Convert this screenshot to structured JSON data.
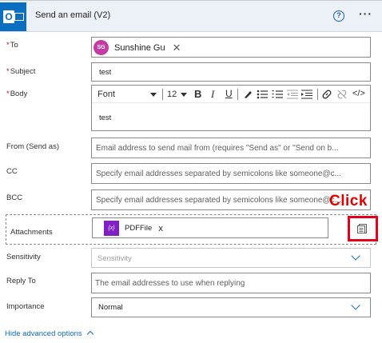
{
  "header": {
    "title": "Send an email (V2)",
    "help_icon": "help-circle-icon",
    "more_icon": "more-horizontal-icon",
    "more_glyph": "···",
    "help_glyph": "?"
  },
  "fields": {
    "to": {
      "required_mark": "*",
      "label": "To",
      "recipient_initials": "SG",
      "recipient_name": "Sunshine Gu",
      "remove_glyph": "✕"
    },
    "subject": {
      "required_mark": "*",
      "label": "Subject",
      "value": "test"
    },
    "body": {
      "required_mark": "*",
      "label": "Body",
      "font": "Font",
      "font_size": "12",
      "value": "test",
      "toolbar": {
        "bold": "B",
        "italic": "I",
        "underline": "U",
        "code": "</>"
      }
    },
    "from": {
      "label": "From (Send as)",
      "placeholder": "Email address to send mail from (requires \"Send as\" or \"Send on b..."
    },
    "cc": {
      "label": "CC",
      "placeholder": "Specify email addresses separated by semicolons like someone@c..."
    },
    "bcc": {
      "label": "BCC",
      "placeholder": "Specify email addresses separated by semicolons like someone@c..."
    },
    "attachments": {
      "label": "Attachments",
      "token_icon": "{x}",
      "token_label": "PDFFile",
      "token_remove": "x"
    },
    "sensitivity": {
      "label": "Sensitivity",
      "placeholder": "Sensitivity"
    },
    "reply_to": {
      "label": "Reply To",
      "placeholder": "The email addresses to use when replying"
    },
    "importance": {
      "label": "Importance",
      "value": "Normal"
    }
  },
  "annotation": {
    "text": "Click",
    "color": "#e00000"
  },
  "footer": {
    "advanced_label": "Hide advanced options"
  },
  "colors": {
    "accent": "#0f6cbd",
    "header_bg": "#ecf1f7",
    "outlook_blue": "#0a6fc0",
    "avatar": "#c43ba5",
    "token": "#8020c4",
    "required": "#c50f1f"
  }
}
